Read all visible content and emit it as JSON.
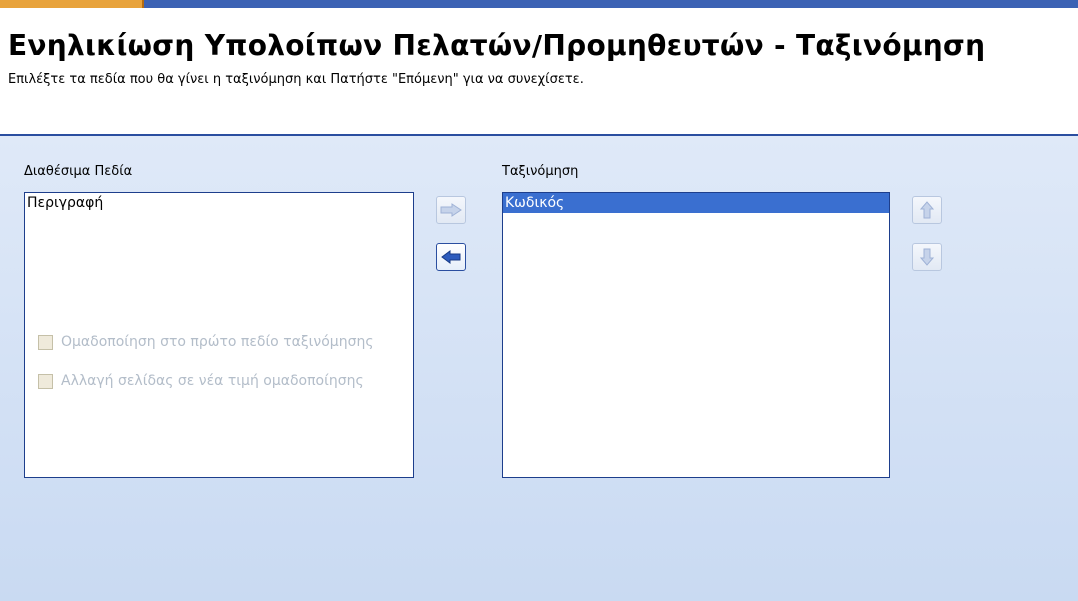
{
  "header": {
    "title": "Ενηλικίωση Υπολοίπων Πελατών/Προμηθευτών - Ταξινόμηση",
    "subtitle": "Επιλέξτε τα πεδία που θα γίνει η ταξινόμηση και Πατήστε \"Επόμενη\" για να συνεχίσετε."
  },
  "available_fields": {
    "label": "Διαθέσιμα Πεδία",
    "items": [
      {
        "text": "Περιγραφή",
        "selected": false
      }
    ]
  },
  "sort_fields": {
    "label": "Ταξινόμηση",
    "items": [
      {
        "text": "Κωδικός",
        "selected": true
      }
    ]
  },
  "buttons": {
    "add": {
      "icon": "arrow-right-icon",
      "enabled": false
    },
    "remove": {
      "icon": "arrow-left-icon",
      "enabled": true
    },
    "move_up": {
      "icon": "arrow-up-icon",
      "enabled": false
    },
    "move_down": {
      "icon": "arrow-down-icon",
      "enabled": false
    }
  },
  "options": {
    "group_by_first": {
      "label": "Ομαδοποίηση στο πρώτο πεδίο ταξινόμησης",
      "checked": false,
      "enabled": false
    },
    "page_break": {
      "label": "Αλλαγή σελίδας σε νέα τιμή ομαδοποίησης",
      "checked": false,
      "enabled": false
    }
  },
  "colors": {
    "accent": "#2a4ea0",
    "selection": "#3a6fd0",
    "panel_background": "#d6e3f6",
    "disabled_text": "#b3bdc9"
  }
}
